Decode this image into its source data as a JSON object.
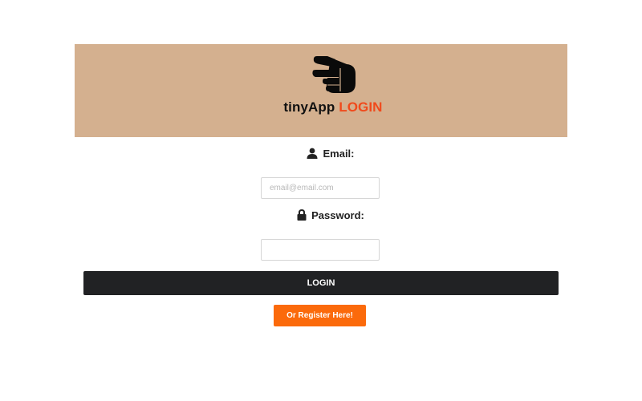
{
  "header": {
    "brand_app": "tinyApp",
    "brand_login": "LOGIN",
    "logo_icon": "pointing-hand-icon",
    "background_color": "#d4b08f",
    "accent_color": "#f04a1c"
  },
  "form": {
    "email": {
      "label": "Email:",
      "icon": "user-icon",
      "value": "",
      "placeholder": "email@email.com"
    },
    "password": {
      "label": "Password:",
      "icon": "lock-icon",
      "value": "",
      "placeholder": ""
    },
    "login_button_label": "LOGIN",
    "login_button_color": "#212224",
    "register_button_label": "Or Register Here!",
    "register_button_color": "#fb6a0b"
  }
}
